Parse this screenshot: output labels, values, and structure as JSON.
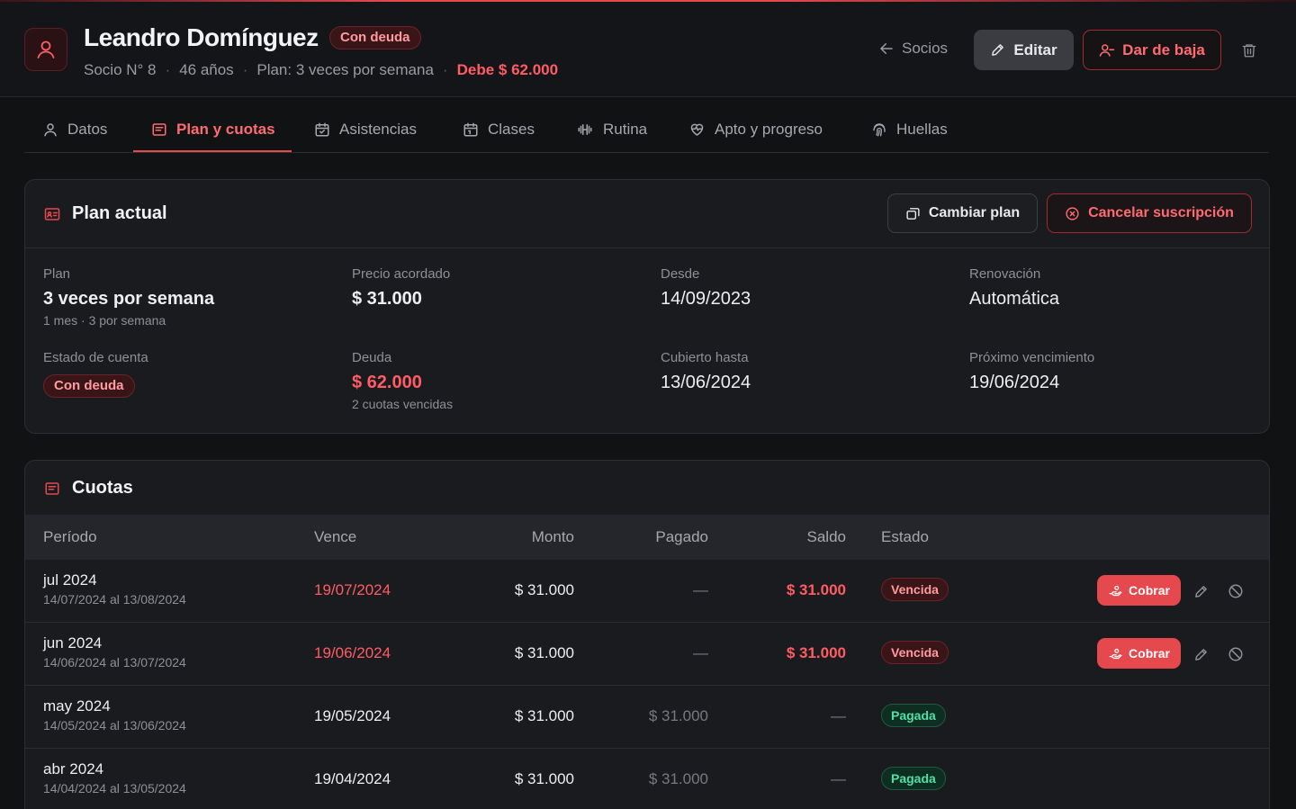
{
  "colors": {
    "accent": "#e5484d",
    "debt": "#ff5c63",
    "paid": "#4fe0a4",
    "background": "#111214",
    "card": "#1a1b1f"
  },
  "header": {
    "name": "Leandro Domínguez",
    "status_badge": "Con deuda",
    "socio": "Socio N° 8",
    "age": "46 años",
    "plan": "Plan: 3 veces por semana",
    "debt": "Debe $ 62.000",
    "back_label": "Socios",
    "edit_label": "Editar",
    "baja_label": "Dar de baja"
  },
  "tabs": [
    {
      "label": "Datos",
      "icon": "user-icon"
    },
    {
      "label": "Plan y cuotas",
      "icon": "receipt-icon",
      "active": true
    },
    {
      "label": "Asistencias",
      "icon": "calendar-check-icon"
    },
    {
      "label": "Clases",
      "icon": "calendar-icon"
    },
    {
      "label": "Rutina",
      "icon": "dumbbell-icon"
    },
    {
      "label": "Apto y progreso",
      "icon": "heart-pulse-icon"
    },
    {
      "label": "Huellas",
      "icon": "fingerprint-icon"
    }
  ],
  "plan_card": {
    "title": "Plan actual",
    "change_label": "Cambiar plan",
    "cancel_label": "Cancelar suscripción",
    "fields": {
      "plan": {
        "label": "Plan",
        "value": "3 veces por semana",
        "sub": "1 mes · 3 por semana"
      },
      "price": {
        "label": "Precio acordado",
        "value": "$ 31.000"
      },
      "since": {
        "label": "Desde",
        "value": "14/09/2023"
      },
      "renewal": {
        "label": "Renovación",
        "value": "Automática"
      },
      "account": {
        "label": "Estado de cuenta",
        "value": "Con deuda"
      },
      "debt": {
        "label": "Deuda",
        "value": "$ 62.000",
        "sub": "2 cuotas vencidas"
      },
      "covered": {
        "label": "Cubierto hasta",
        "value": "13/06/2024"
      },
      "next_due": {
        "label": "Próximo vencimiento",
        "value": "19/06/2024"
      }
    }
  },
  "cuotas": {
    "title": "Cuotas",
    "columns": [
      "Período",
      "Vence",
      "Monto",
      "Pagado",
      "Saldo",
      "Estado"
    ],
    "cobrar_label": "Cobrar",
    "rows": [
      {
        "period": "jul 2024",
        "range": "14/07/2024 al 13/08/2024",
        "due": "19/07/2024",
        "amount": "$ 31.000",
        "paid": "—",
        "balance": "$ 31.000",
        "status": "Vencida"
      },
      {
        "period": "jun 2024",
        "range": "14/06/2024 al 13/07/2024",
        "due": "19/06/2024",
        "amount": "$ 31.000",
        "paid": "—",
        "balance": "$ 31.000",
        "status": "Vencida"
      },
      {
        "period": "may 2024",
        "range": "14/05/2024 al 13/06/2024",
        "due": "19/05/2024",
        "amount": "$ 31.000",
        "paid": "$ 31.000",
        "balance": "—",
        "status": "Pagada"
      },
      {
        "period": "abr 2024",
        "range": "14/04/2024 al 13/05/2024",
        "due": "19/04/2024",
        "amount": "$ 31.000",
        "paid": "$ 31.000",
        "balance": "—",
        "status": "Pagada"
      }
    ]
  }
}
